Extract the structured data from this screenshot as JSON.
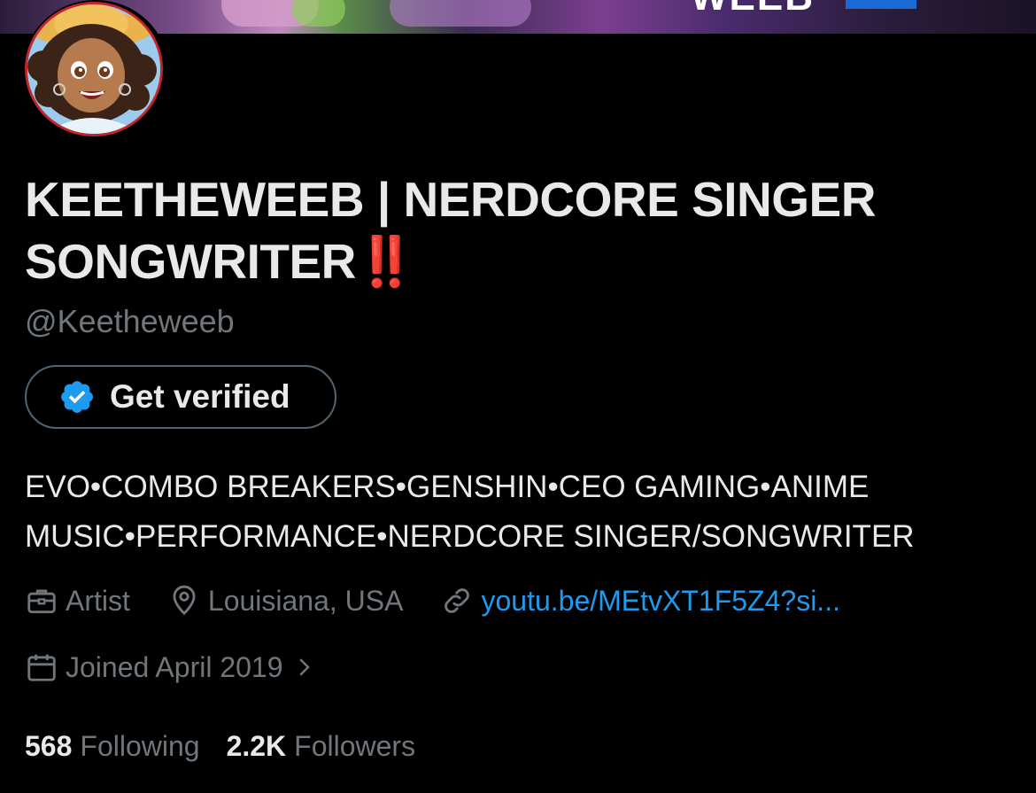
{
  "banner": {
    "text": "WEEB"
  },
  "profile": {
    "display_name": "KEETHEWEEB | NERDCORE SINGER SONGWRITER",
    "name_emoji": "‼️",
    "handle": "@Keetheweeb",
    "verify_button": "Get verified",
    "bio_line1": "EVO•COMBO BREAKERS•GENSHIN•CEO GAMING•ANIME",
    "bio_line2": "MUSIC•PERFORMANCE•NERDCORE SINGER/SONGWRITER",
    "category": "Artist",
    "location": "Louisiana, USA",
    "link": "youtu.be/MEtvXT1F5Z4?si...",
    "joined": "Joined April 2019"
  },
  "stats": {
    "following_count": "568",
    "following_label": "Following",
    "followers_count": "2.2K",
    "followers_label": "Followers"
  },
  "colors": {
    "background": "#000000",
    "text": "#e7e9ea",
    "muted": "#71767b",
    "link": "#1d9bf0",
    "avatar_ring": "#c2262c",
    "emoji_red": "#e0242b"
  },
  "icons": [
    "verified-badge-icon",
    "briefcase-icon",
    "location-pin-icon",
    "link-icon",
    "calendar-icon",
    "chevron-right-icon"
  ]
}
